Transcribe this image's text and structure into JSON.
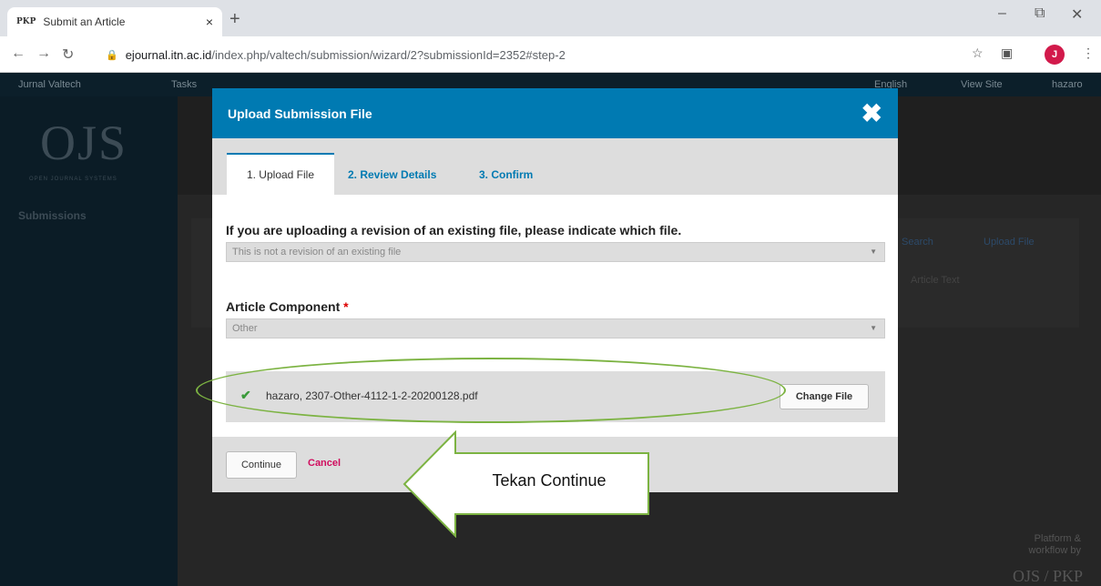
{
  "browser": {
    "tab_title": "Submit an Article",
    "tab_favicon": "PKP",
    "tab_close": "×",
    "new_tab": "+",
    "url_host": "ejournal.itn.ac.id",
    "url_path": "/index.php/valtech/submission/wizard/2?submissionId=2352#step-2",
    "avatar_letter": "J"
  },
  "backdrop": {
    "site_name": "Jurnal Valtech",
    "tasks": "Tasks",
    "language": "English",
    "view_site": "View Site",
    "user": "hazaro",
    "logo": "OJS",
    "logo_sub": "OPEN JOURNAL SYSTEMS",
    "sidebar_link": "Submissions",
    "search": "Search",
    "upload_file": "Upload File",
    "article_text": "Article Text",
    "footer_line1": "Platform &",
    "footer_line2": "workflow by",
    "footer_logo": "OJS / PKP"
  },
  "modal": {
    "title": "Upload Submission File",
    "tabs": [
      {
        "label": "1. Upload File"
      },
      {
        "label": "2. Review Details"
      },
      {
        "label": "3. Confirm"
      }
    ],
    "revision_label": "If you are uploading a revision of an existing file, please indicate which file.",
    "revision_value": "This is not a revision of an existing file",
    "component_label": "Article Component",
    "component_required": "*",
    "component_value": "Other",
    "file_name": "hazaro, 2307-Other-4112-1-2-20200128.pdf",
    "change_file": "Change File",
    "continue": "Continue",
    "cancel": "Cancel"
  },
  "annotation": {
    "callout_text": "Tekan Continue",
    "color": "#7cb342"
  }
}
